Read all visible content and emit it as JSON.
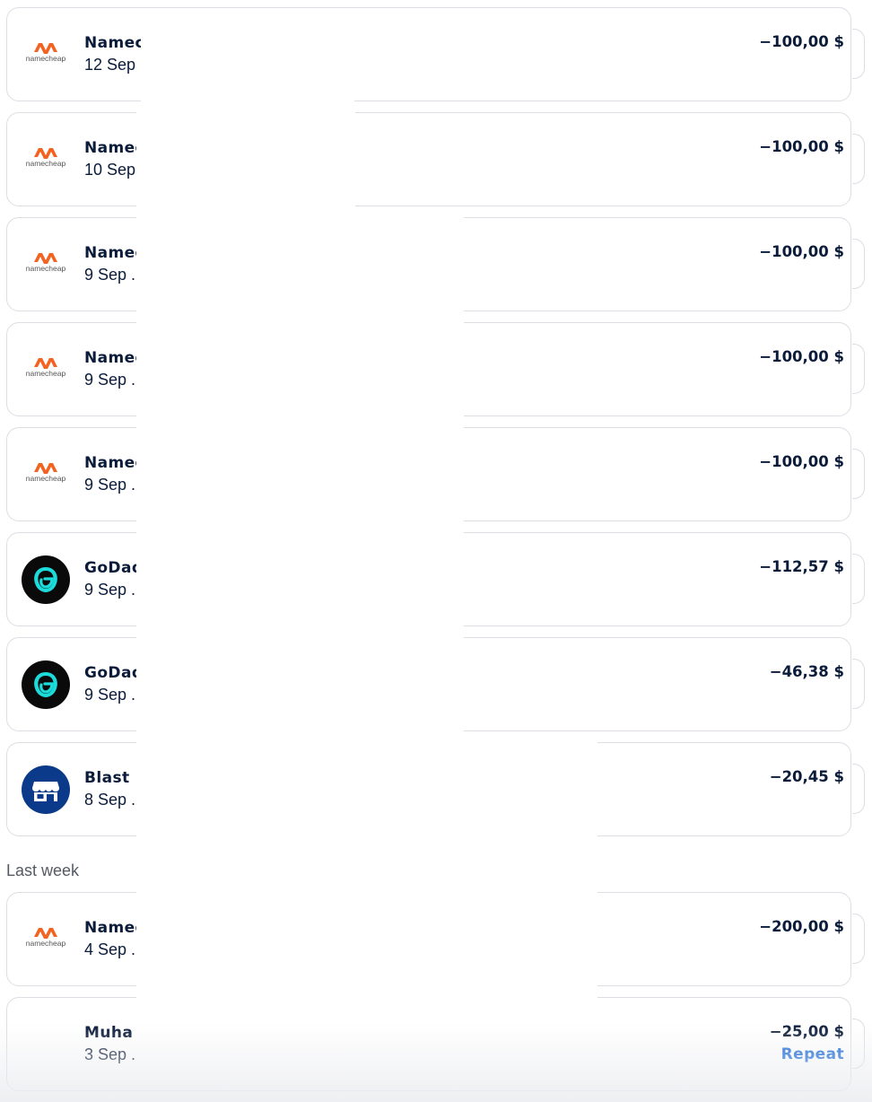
{
  "transactions_recent": [
    {
      "merchant": "Namecheap",
      "date": "12 Sep .",
      "amount": "−100,00 $",
      "logo": "namecheap"
    },
    {
      "merchant": "Namecheap",
      "date": "10 Sep .",
      "amount": "−100,00 $",
      "logo": "namecheap"
    },
    {
      "merchant": "Namecheap",
      "date": "9 Sep .",
      "amount": "−100,00 $",
      "logo": "namecheap"
    },
    {
      "merchant": "Namecheap",
      "date": "9 Sep .",
      "amount": "−100,00 $",
      "logo": "namecheap"
    },
    {
      "merchant": "Namecheap",
      "date": "9 Sep .",
      "amount": "−100,00 $",
      "logo": "namecheap"
    },
    {
      "merchant": "GoDaddy",
      "date": "9 Sep .",
      "amount": "−112,57 $",
      "logo": "godaddy"
    },
    {
      "merchant": "GoDaddy",
      "date": "9 Sep .",
      "amount": "−46,38 $",
      "logo": "godaddy"
    },
    {
      "merchant": "Blast",
      "date": "8 Sep .",
      "amount": "−20,45 $",
      "logo": "store"
    }
  ],
  "section_last_week": "Last week",
  "transactions_last_week": [
    {
      "merchant": "Namecheap",
      "date": "4 Sep .",
      "amount": "−200,00 $",
      "logo": "namecheap"
    },
    {
      "merchant": "Muha",
      "date": "3 Sep .",
      "amount": "−25,00 $",
      "logo": "blank",
      "action": "Repeat"
    }
  ],
  "logo_text": {
    "namecheap": "namecheap"
  },
  "colors": {
    "text_primary": "#0b1b3a",
    "link_blue": "#1566d6",
    "namecheap_orange": "#f26322",
    "godaddy_teal": "#1bdbdb",
    "blast_blue": "#0c3a8b",
    "section_label": "#555a63"
  }
}
